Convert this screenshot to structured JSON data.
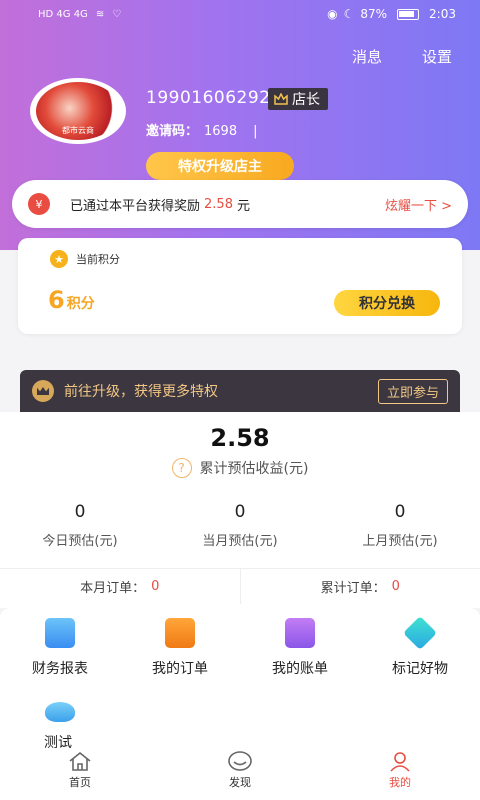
{
  "status": {
    "battery": "87%",
    "time": "2:03",
    "left_text": "HD 4G 4G"
  },
  "header": {
    "messages": "消息",
    "settings": "设置"
  },
  "profile": {
    "phone": "19901606292",
    "role": "店长",
    "invite_label": "邀请码：",
    "invite_code": "1698",
    "cursor": "|",
    "avatar_caption": "都市云商",
    "upgrade_label": "特权升级店主"
  },
  "reward": {
    "prefix": "已通过本平台获得奖励",
    "amount": "2.58",
    "unit": "元",
    "action": "炫耀一下 >"
  },
  "points": {
    "title": "当前积分",
    "value": "6",
    "unit": "积分",
    "exchange": "积分兑换"
  },
  "banner": {
    "text": "前往升级，获得更多特权",
    "button": "立即参与"
  },
  "earnings": {
    "total": "2.58",
    "total_label": "累计预估收益(元)",
    "stats": [
      {
        "value": "0",
        "label": "今日预估(元)"
      },
      {
        "value": "0",
        "label": "当月预估(元)"
      },
      {
        "value": "0",
        "label": "上月预估(元)"
      }
    ],
    "month_orders_label": "本月订单：",
    "month_orders": "0",
    "total_orders_label": "累计订单：",
    "total_orders": "0"
  },
  "tools": [
    {
      "label": "财务报表",
      "icon": "report-icon"
    },
    {
      "label": "我的订单",
      "icon": "orders-icon"
    },
    {
      "label": "我的账单",
      "icon": "bill-icon"
    },
    {
      "label": "标记好物",
      "icon": "tag-icon"
    },
    {
      "label": "测试",
      "icon": "cloud-icon"
    }
  ],
  "tabs": [
    {
      "label": "首页",
      "icon": "home-icon"
    },
    {
      "label": "发现",
      "icon": "discover-icon"
    },
    {
      "label": "我的",
      "icon": "profile-icon"
    }
  ],
  "colors": {
    "accent": "#e94d42",
    "gold": "#f6a623",
    "hero_start": "#c26fd9",
    "hero_end": "#7e78f4"
  }
}
